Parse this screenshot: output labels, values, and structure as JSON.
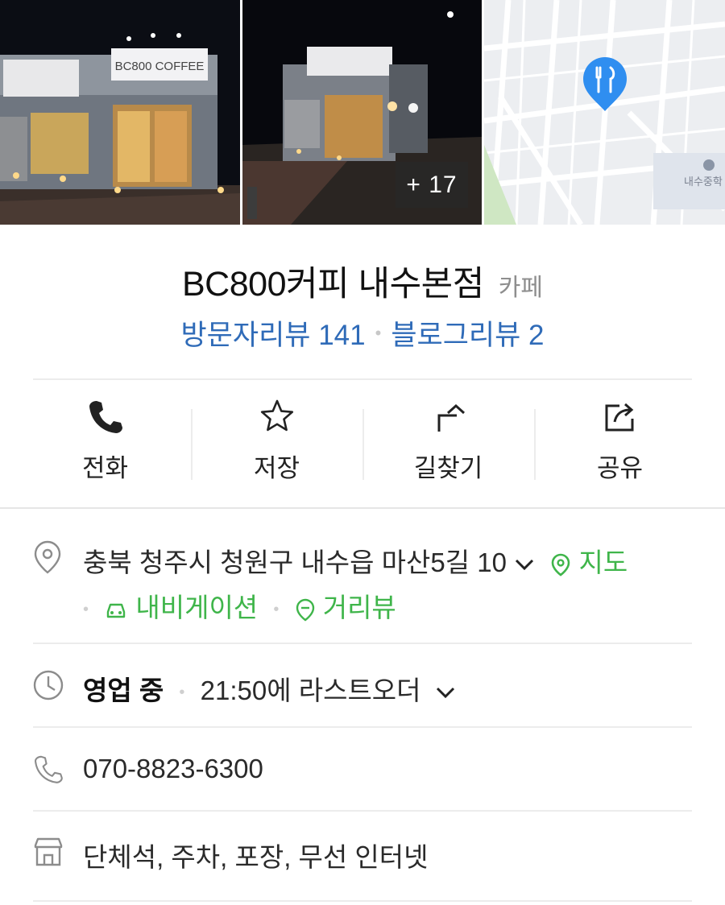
{
  "photos": {
    "more_count": "+ 17",
    "sign_text": "BC800 COFFEE"
  },
  "place": {
    "name": "BC800커피 내수본점",
    "category": "카페"
  },
  "reviews": {
    "visitor": "방문자리뷰 141",
    "blog": "블로그리뷰 2"
  },
  "actions": [
    {
      "label": "전화",
      "icon": "phone-icon"
    },
    {
      "label": "저장",
      "icon": "star-icon"
    },
    {
      "label": "길찾기",
      "icon": "directions-icon"
    },
    {
      "label": "공유",
      "icon": "share-icon"
    }
  ],
  "address": {
    "text": "충북 청주시 청원구 내수읍 마산5길 10",
    "map_link": "지도",
    "navigation_link": "내비게이션",
    "street_view_link": "거리뷰"
  },
  "hours": {
    "status": "영업 중",
    "last_order": "21:50에 라스트오더"
  },
  "phone": {
    "number": "070-8823-6300"
  },
  "amenities": {
    "text": "단체석, 주차, 포장, 무선 인터넷"
  },
  "map": {
    "label": "내수중학",
    "pin_color": "#2f8ef0"
  },
  "colors": {
    "link_blue": "#2f6bb8",
    "link_green": "#3fb54a"
  }
}
